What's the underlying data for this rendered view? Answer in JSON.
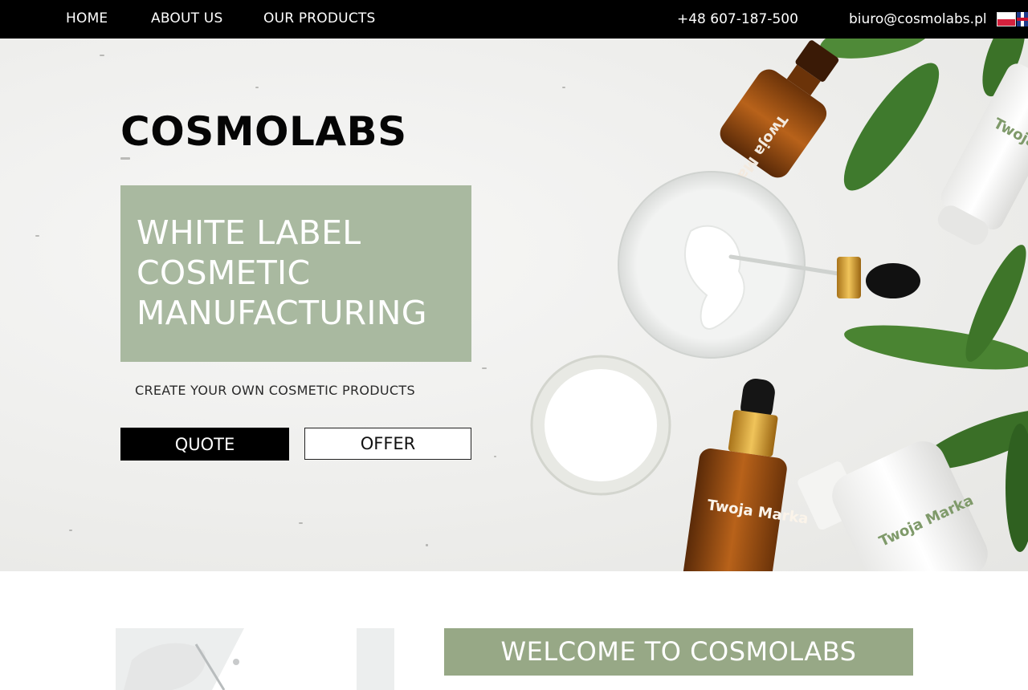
{
  "nav": {
    "links": [
      "HOME",
      "ABOUT US",
      "OUR PRODUCTS"
    ],
    "phone": "+48 607-187-500",
    "email": "biuro@cosmolabs.pl",
    "languages": [
      "pl-flag-icon",
      "uk-flag-icon"
    ]
  },
  "hero": {
    "brand": "COSMOLABS",
    "tagline": "WHITE LABEL COSMETIC MANUFACTURING",
    "subtitle": "CREATE YOUR OWN COSMETIC PRODUCTS",
    "quote_label": "QUOTE",
    "offer_label": "OFFER",
    "product_label": "Twoja Marka"
  },
  "welcome": {
    "title": "WELCOME TO  COSMOLABS"
  },
  "colors": {
    "nav_bg": "#000000",
    "tagline_box": "#a9b9a0",
    "welcome_box": "#97a886",
    "quote_button": "#000000"
  }
}
